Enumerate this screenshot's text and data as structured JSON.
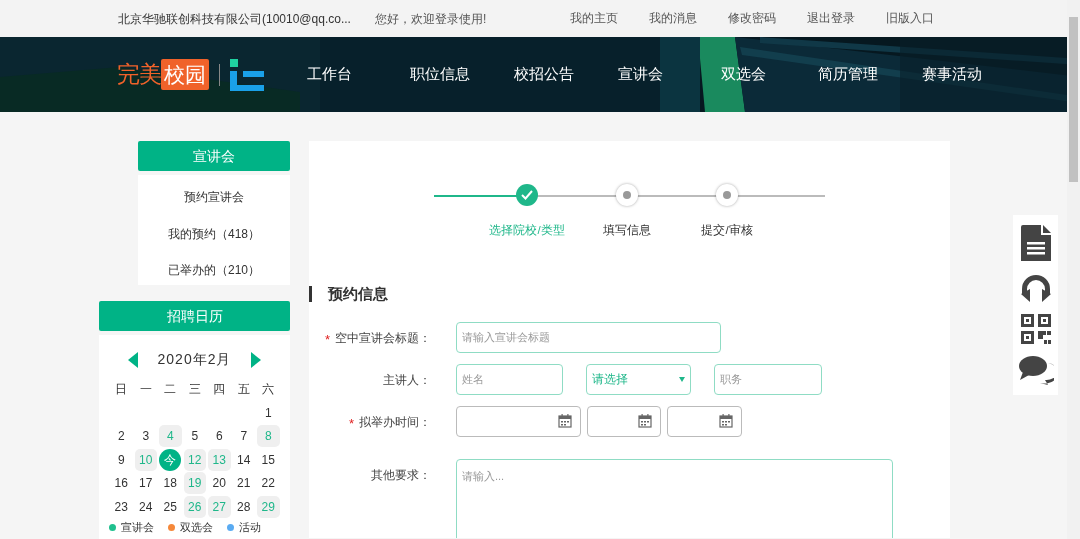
{
  "top_bar": {
    "company": "北京华驰联创科技有限公司(10010@qq.co...",
    "greeting": "您好，欢迎登录使用!",
    "links": [
      "我的主页",
      "我的消息",
      "修改密码",
      "退出登录",
      "旧版入口"
    ]
  },
  "header": {
    "logo_a": "完美",
    "logo_b": "校园",
    "nav": [
      "工作台",
      "职位信息",
      "校招公告",
      "宣讲会",
      "双选会",
      "简历管理",
      "赛事活动"
    ]
  },
  "sidebar": {
    "menu_title": "宣讲会",
    "menu_items": [
      "预约宣讲会",
      "我的预约（418）",
      "已举办的（210）"
    ]
  },
  "calendar": {
    "title": "招聘日历",
    "month": "2020年2月",
    "weekdays": [
      "日",
      "一",
      "二",
      "三",
      "四",
      "五",
      "六"
    ],
    "weeks": [
      [
        {
          "label": "1",
          "event": false,
          "today": false
        }
      ],
      [
        {
          "label": "2",
          "event": false,
          "today": false
        },
        {
          "label": "3",
          "event": false,
          "today": false
        },
        {
          "label": "4",
          "event": true,
          "today": false
        },
        {
          "label": "5",
          "event": false,
          "today": false
        },
        {
          "label": "6",
          "event": false,
          "today": false
        },
        {
          "label": "7",
          "event": false,
          "today": false
        },
        {
          "label": "8",
          "event": true,
          "today": false
        }
      ],
      [
        {
          "label": "9",
          "event": false,
          "today": false
        },
        {
          "label": "10",
          "event": true,
          "today": false
        },
        {
          "label": "今",
          "event": false,
          "today": true
        },
        {
          "label": "12",
          "event": true,
          "today": false
        },
        {
          "label": "13",
          "event": true,
          "today": false
        },
        {
          "label": "14",
          "event": false,
          "today": false
        },
        {
          "label": "15",
          "event": false,
          "today": false
        }
      ],
      [
        {
          "label": "16",
          "event": false,
          "today": false
        },
        {
          "label": "17",
          "event": false,
          "today": false
        },
        {
          "label": "18",
          "event": false,
          "today": false
        },
        {
          "label": "19",
          "event": true,
          "today": false
        },
        {
          "label": "20",
          "event": false,
          "today": false
        },
        {
          "label": "21",
          "event": false,
          "today": false
        },
        {
          "label": "22",
          "event": false,
          "today": false
        }
      ],
      [
        {
          "label": "23",
          "event": false,
          "today": false
        },
        {
          "label": "24",
          "event": false,
          "today": false
        },
        {
          "label": "25",
          "event": false,
          "today": false
        },
        {
          "label": "26",
          "event": true,
          "today": false
        },
        {
          "label": "27",
          "event": true,
          "today": false
        },
        {
          "label": "28",
          "event": false,
          "today": false
        },
        {
          "label": "29",
          "event": true,
          "today": false
        }
      ]
    ],
    "legend": [
      {
        "label": "宣讲会",
        "color": "#1fc08e"
      },
      {
        "label": "双选会",
        "color": "#f5883a"
      },
      {
        "label": "活动",
        "color": "#5aabf2"
      }
    ]
  },
  "steps": [
    {
      "label": "选择院校/类型",
      "done": true
    },
    {
      "label": "填写信息",
      "done": false
    },
    {
      "label": "提交/审核",
      "done": false
    }
  ],
  "form": {
    "section_title": "预约信息",
    "rows": [
      {
        "label": "空中宣讲会标题：",
        "required_mark": "*",
        "fields": [
          {
            "kind": "text",
            "placeholder": "请输入宣讲会标题"
          }
        ]
      },
      {
        "label": "主讲人：",
        "fields": [
          {
            "kind": "text",
            "placeholder": "姓名"
          },
          {
            "kind": "select",
            "value": "请选择"
          },
          {
            "kind": "text",
            "placeholder": "职务"
          }
        ]
      },
      {
        "label": "拟举办时间：",
        "required_mark": "*",
        "fields": [
          {
            "kind": "date"
          },
          {
            "kind": "date"
          },
          {
            "kind": "date"
          }
        ]
      },
      {
        "label": "其他要求：",
        "fields": [
          {
            "kind": "textarea",
            "placeholder": "请输入..."
          }
        ]
      }
    ]
  }
}
